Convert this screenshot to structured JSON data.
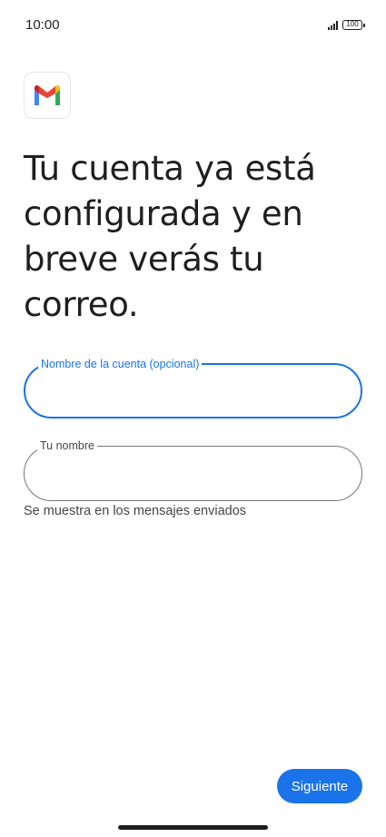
{
  "status_bar": {
    "time": "10:00",
    "battery_level": "100",
    "signal_icon": "signal-bars-icon",
    "battery_icon": "battery-icon"
  },
  "app": {
    "logo_icon": "gmail-logo-icon"
  },
  "headline": "Tu cuenta ya está configurada y en breve verás tu correo.",
  "form": {
    "account_name": {
      "label": "Nombre de la cuenta (opcional)",
      "value": "",
      "state": "focused"
    },
    "your_name": {
      "label": "Tu nombre",
      "value": "",
      "helper": "Se muestra en los mensajes enviados"
    }
  },
  "actions": {
    "next_label": "Siguiente"
  },
  "colors": {
    "accent": "#1a73e8",
    "text": "#1f1f1f",
    "outline": "#747775",
    "helper_text": "#444746"
  }
}
